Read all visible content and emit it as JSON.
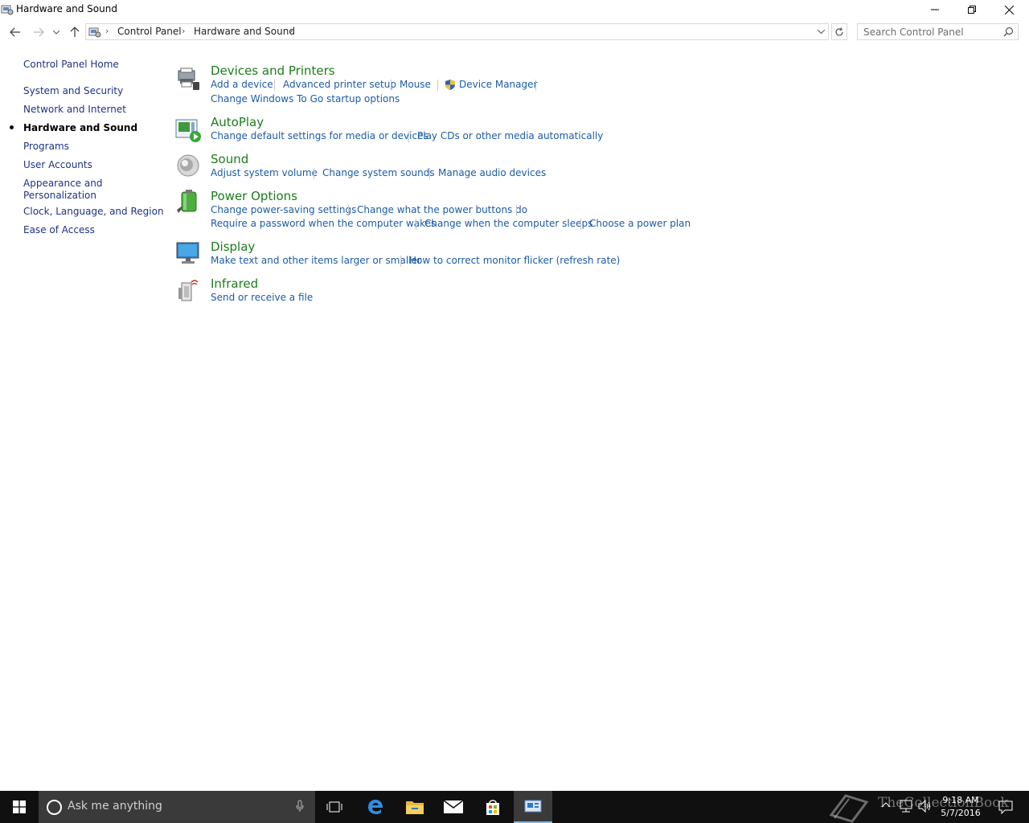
{
  "window": {
    "title": "Hardware and Sound"
  },
  "navigation": {
    "breadcrumb": [
      "Control Panel",
      "Hardware and Sound"
    ],
    "search_placeholder": "Search Control Panel"
  },
  "leftnav": {
    "home": "Control Panel Home",
    "items": [
      {
        "label": "System and Security"
      },
      {
        "label": "Network and Internet"
      },
      {
        "label": "Hardware and Sound",
        "current": true
      },
      {
        "label": "Programs"
      },
      {
        "label": "User Accounts"
      },
      {
        "label": "Appearance and Personalization",
        "line1": "Appearance and",
        "line2": "Personalization"
      },
      {
        "label": "Clock, Language, and Region"
      },
      {
        "label": "Ease of Access"
      }
    ]
  },
  "categories": [
    {
      "title": "Devices and Printers",
      "icon": "devices-printers-icon",
      "links": [
        "Add a device",
        "Advanced printer setup",
        "Mouse",
        "Device Manager",
        "Change Windows To Go startup options"
      ]
    },
    {
      "title": "AutoPlay",
      "icon": "autoplay-icon",
      "links": [
        "Change default settings for media or devices",
        "Play CDs or other media automatically"
      ]
    },
    {
      "title": "Sound",
      "icon": "speaker-icon",
      "links": [
        "Adjust system volume",
        "Change system sounds",
        "Manage audio devices"
      ]
    },
    {
      "title": "Power Options",
      "icon": "battery-icon",
      "links": [
        "Change power-saving settings",
        "Change what the power buttons do",
        "Require a password when the computer wakes",
        "Change when the computer sleeps",
        "Choose a power plan"
      ]
    },
    {
      "title": "Display",
      "icon": "monitor-icon",
      "links": [
        "Make text and other items larger or smaller",
        "How to correct monitor flicker (refresh rate)"
      ]
    },
    {
      "title": "Infrared",
      "icon": "infrared-icon",
      "links": [
        "Send or receive a file"
      ]
    }
  ],
  "taskbar": {
    "search_text": "Ask me anything",
    "time": "9:18 AM",
    "date": "5/7/2016",
    "watermark": "TheCollectionBook"
  },
  "colors": {
    "category_title": "#1b7d1b",
    "link": "#1c5ba8",
    "nav_link": "#1e3287",
    "taskbar": "#101010"
  }
}
